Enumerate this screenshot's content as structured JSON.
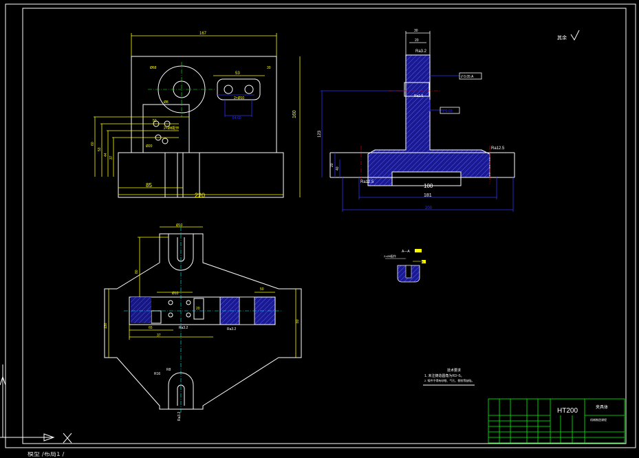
{
  "drawing": {
    "rough_mark": "其余",
    "material": "HT200",
    "title_block_name": "夹具体",
    "title_block_sub": "机械制造课程",
    "tech_req_title": "技术要求",
    "tech_req_1": "1. 未注铸造圆角为R3~5。",
    "tech_req_2": "2. 铸件不得有砂眼、气孔、裂纹等缺陷。",
    "section_label": "A—A",
    "front_view": {
      "dim_top": "167",
      "dim_bottom_total": "220",
      "dim_bottom_left": "85",
      "dim_right_height": "160",
      "dim_slot": "53",
      "dim_slot_h": "30",
      "dim_hole": "Ø68",
      "dim_hole2": "Ø8",
      "dim_holes_note": "2×Ø10",
      "dim_sq": "54.60",
      "dim_left_1": "60",
      "dim_left_2": "53",
      "dim_left_3": "44",
      "dim_left_4": "37",
      "dim_h1": "50",
      "dim_h2": "2×Ø8配作",
      "dim_h3": "Ø20"
    },
    "side_view": {
      "dim_top1": "30",
      "dim_top2": "20",
      "rough_top": "Ra3.2",
      "rough_mid": "Ra1.6",
      "rough_right": "Ra12.5",
      "rough_left": "Ra12.5",
      "tol_parallel": "// 0.05 A",
      "tol_perp": "⊥ 0.03",
      "dim_height": "123",
      "dim_left_a": "20",
      "dim_left_b": "40",
      "dim_bottom_inner": "100",
      "dim_bottom_mid": "181",
      "dim_bottom_total": "200"
    },
    "top_view": {
      "dim_slot_top": "Ø10",
      "dim_height": "80",
      "dim_inner": "Ø10",
      "dim_left_a": "65",
      "dim_left_b": "37",
      "dim_width": "50",
      "dim_left_height": "130",
      "dim_right_height": "80",
      "dim_sq": "20",
      "rough_a": "Ra3.2",
      "rough_b": "Ra3.2",
      "r1": "R16",
      "r2": "R8",
      "rough_c": "Ra3.2"
    },
    "section_view": {
      "note": "2×Ø8配作",
      "tag": "A"
    }
  },
  "tabbar": {
    "text": "模型 /布局1 /"
  },
  "colors": {
    "white": "#ffffff",
    "yellow": "#ffff00",
    "blue": "#3030ff",
    "cyan": "#00ffff",
    "green": "#00ff00",
    "red": "#ff0000",
    "hatch": "#3b3bff"
  }
}
